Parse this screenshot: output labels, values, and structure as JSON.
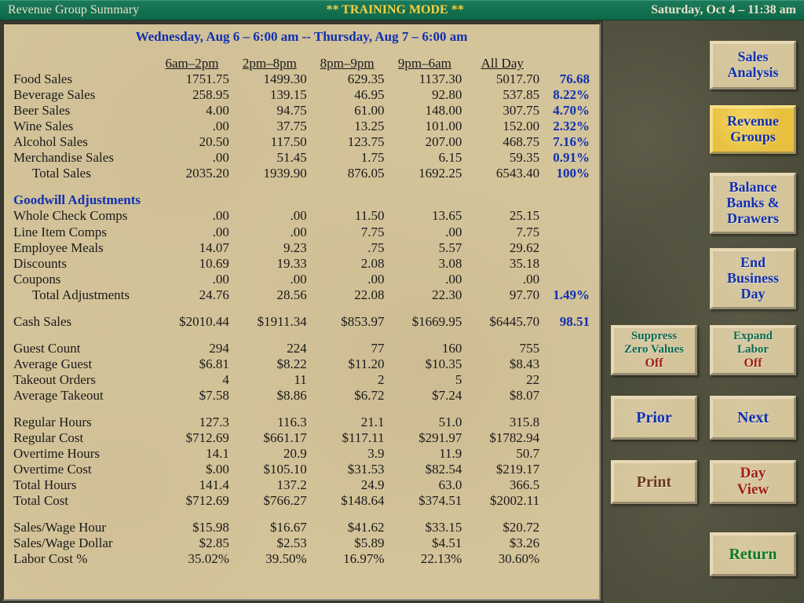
{
  "header": {
    "title": "Revenue Group Summary",
    "mode": "** TRAINING MODE **",
    "datetime": "Saturday, Oct 4 – 11:38 am"
  },
  "report": {
    "range": "Wednesday, Aug 6 – 6:00 am   --   Thursday, Aug 7 – 6:00 am",
    "columns": [
      "6am–2pm",
      "2pm–8pm",
      "8pm–9pm",
      "9pm–6am",
      "All Day"
    ],
    "sales_rows": [
      {
        "label": "Food Sales",
        "c": [
          "1751.75",
          "1499.30",
          "629.35",
          "1137.30",
          "5017.70"
        ],
        "pct": "76.68"
      },
      {
        "label": "Beverage Sales",
        "c": [
          "258.95",
          "139.15",
          "46.95",
          "92.80",
          "537.85"
        ],
        "pct": "8.22%"
      },
      {
        "label": "Beer Sales",
        "c": [
          "4.00",
          "94.75",
          "61.00",
          "148.00",
          "307.75"
        ],
        "pct": "4.70%"
      },
      {
        "label": "Wine Sales",
        "c": [
          ".00",
          "37.75",
          "13.25",
          "101.00",
          "152.00"
        ],
        "pct": "2.32%"
      },
      {
        "label": "Alcohol Sales",
        "c": [
          "20.50",
          "117.50",
          "123.75",
          "207.00",
          "468.75"
        ],
        "pct": "7.16%"
      },
      {
        "label": "Merchandise Sales",
        "c": [
          ".00",
          "51.45",
          "1.75",
          "6.15",
          "59.35"
        ],
        "pct": "0.91%"
      }
    ],
    "total_sales": {
      "label": "Total Sales",
      "c": [
        "2035.20",
        "1939.90",
        "876.05",
        "1692.25",
        "6543.40"
      ],
      "pct": "100%"
    },
    "adjustments_header": "Goodwill Adjustments",
    "adj_rows": [
      {
        "label": "Whole Check Comps",
        "c": [
          ".00",
          ".00",
          "11.50",
          "13.65",
          "25.15"
        ]
      },
      {
        "label": "Line Item Comps",
        "c": [
          ".00",
          ".00",
          "7.75",
          ".00",
          "7.75"
        ]
      },
      {
        "label": "Employee Meals",
        "c": [
          "14.07",
          "9.23",
          ".75",
          "5.57",
          "29.62"
        ]
      },
      {
        "label": "Discounts",
        "c": [
          "10.69",
          "19.33",
          "2.08",
          "3.08",
          "35.18"
        ]
      },
      {
        "label": "Coupons",
        "c": [
          ".00",
          ".00",
          ".00",
          ".00",
          ".00"
        ]
      }
    ],
    "total_adjustments": {
      "label": "Total Adjustments",
      "c": [
        "24.76",
        "28.56",
        "22.08",
        "22.30",
        "97.70"
      ],
      "pct": "1.49%"
    },
    "cash_sales": {
      "label": "Cash Sales",
      "c": [
        "$2010.44",
        "$1911.34",
        "$853.97",
        "$1669.95",
        "$6445.70"
      ],
      "pct": "98.51"
    },
    "guest_rows": [
      {
        "label": "Guest Count",
        "c": [
          "294",
          "224",
          "77",
          "160",
          "755"
        ]
      },
      {
        "label": "Average Guest",
        "c": [
          "$6.81",
          "$8.22",
          "$11.20",
          "$10.35",
          "$8.43"
        ]
      },
      {
        "label": "Takeout Orders",
        "c": [
          "4",
          "11",
          "2",
          "5",
          "22"
        ]
      },
      {
        "label": "Average Takeout",
        "c": [
          "$7.58",
          "$8.86",
          "$6.72",
          "$7.24",
          "$8.07"
        ]
      }
    ],
    "labor_rows": [
      {
        "label": "Regular Hours",
        "c": [
          "127.3",
          "116.3",
          "21.1",
          "51.0",
          "315.8"
        ]
      },
      {
        "label": "Regular Cost",
        "c": [
          "$712.69",
          "$661.17",
          "$117.11",
          "$291.97",
          "$1782.94"
        ]
      },
      {
        "label": "Overtime Hours",
        "c": [
          "14.1",
          "20.9",
          "3.9",
          "11.9",
          "50.7"
        ]
      },
      {
        "label": "Overtime Cost",
        "c": [
          "$.00",
          "$105.10",
          "$31.53",
          "$82.54",
          "$219.17"
        ]
      },
      {
        "label": "Total Hours",
        "c": [
          "141.4",
          "137.2",
          "24.9",
          "63.0",
          "366.5"
        ]
      },
      {
        "label": "Total Cost",
        "c": [
          "$712.69",
          "$766.27",
          "$148.64",
          "$374.51",
          "$2002.11"
        ]
      }
    ],
    "wage_rows": [
      {
        "label": "Sales/Wage Hour",
        "c": [
          "$15.98",
          "$16.67",
          "$41.62",
          "$33.15",
          "$20.72"
        ]
      },
      {
        "label": "Sales/Wage Dollar",
        "c": [
          "$2.85",
          "$2.53",
          "$5.89",
          "$4.51",
          "$3.26"
        ]
      },
      {
        "label": "Labor Cost %",
        "c": [
          "35.02%",
          "39.50%",
          "16.97%",
          "22.13%",
          "30.60%"
        ]
      }
    ]
  },
  "sidebar": {
    "sales_analysis": "Sales\nAnalysis",
    "revenue_groups": "Revenue\nGroups",
    "balance": "Balance\nBanks &\nDrawers",
    "end_day": "End\nBusiness\nDay",
    "suppress": {
      "label": "Suppress\nZero Values",
      "state": "Off"
    },
    "expand": {
      "label": "Expand\nLabor",
      "state": "Off"
    },
    "prior": "Prior",
    "next": "Next",
    "print": "Print",
    "day_view": "Day\nView",
    "return": "Return"
  }
}
